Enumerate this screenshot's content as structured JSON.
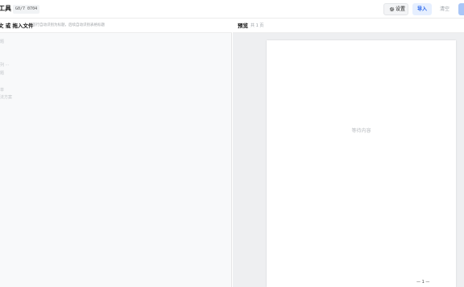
{
  "header": {
    "title": "工具",
    "version": "G0/7 0704",
    "buttons": {
      "settings": "设置",
      "import": "导入",
      "clear": "清空"
    }
  },
  "editor": {
    "title": "文 或 拖入文件",
    "subtitle": "首行自动识别为标题，后续自动识别表格标题",
    "placeholder_lines": [
      "题",
      "列 ···",
      "题",
      "单",
      "法方案"
    ]
  },
  "preview": {
    "title": "预览",
    "page_count": "共 1 页",
    "placeholder": "等待内容",
    "footer": "— 1 —"
  },
  "colors": {
    "accent": "#2563eb",
    "import_bg": "#e6efff",
    "preview_bg": "#eeeff1"
  },
  "icons": {
    "settings": "gear-icon"
  }
}
